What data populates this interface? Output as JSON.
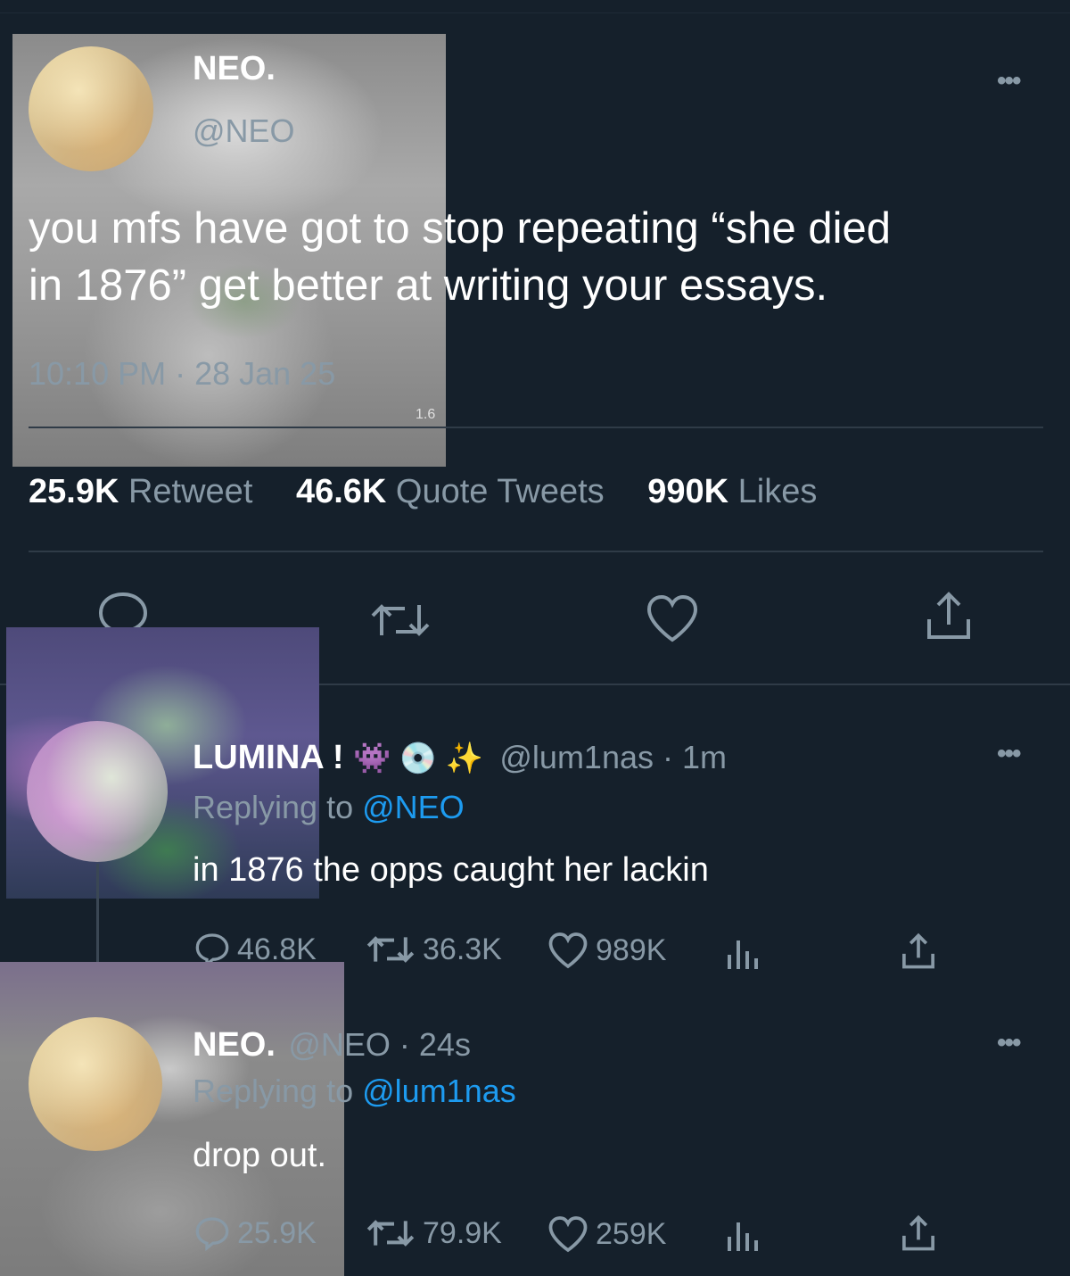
{
  "main_tweet": {
    "name": "NEO.",
    "handle": "@NEO",
    "text_line1": "you mfs have got to stop repeating “she died",
    "text_line2": "in 1876” get better at writing your essays.",
    "timestamp": "10:10 PM · 28 Jan 25",
    "overlay_count": "1.6",
    "stats": {
      "retweets_value": "25.9K",
      "retweets_label": "Retweet",
      "quotes_value": "46.6K",
      "quotes_label": "Quote Tweets",
      "likes_value": "990K",
      "likes_label": "Likes"
    }
  },
  "replies": [
    {
      "name": "LUMINA !",
      "emojis": "👾 💿 ✨",
      "handle_time": "@lum1nas · 1m",
      "replying_label": "Replying to",
      "replying_handle": "@NEO",
      "text": "in 1876 the opps caught her lackin",
      "replies": "46.8K",
      "retweets": "36.3K",
      "likes": "989K"
    },
    {
      "name": "NEO.",
      "handle_time": "@NEO · 24s",
      "replying_label": "Replying to",
      "replying_handle": "@lum1nas",
      "text": "drop out.",
      "replies": "25.9K",
      "retweets": "79.9K",
      "likes": "259K"
    }
  ],
  "colors": {
    "background": "#15202b",
    "muted": "#8899a6",
    "link": "#1d9bf0"
  },
  "icons": [
    "more-icon",
    "reply-icon",
    "retweet-icon",
    "like-icon",
    "share-icon",
    "analytics-icon"
  ]
}
